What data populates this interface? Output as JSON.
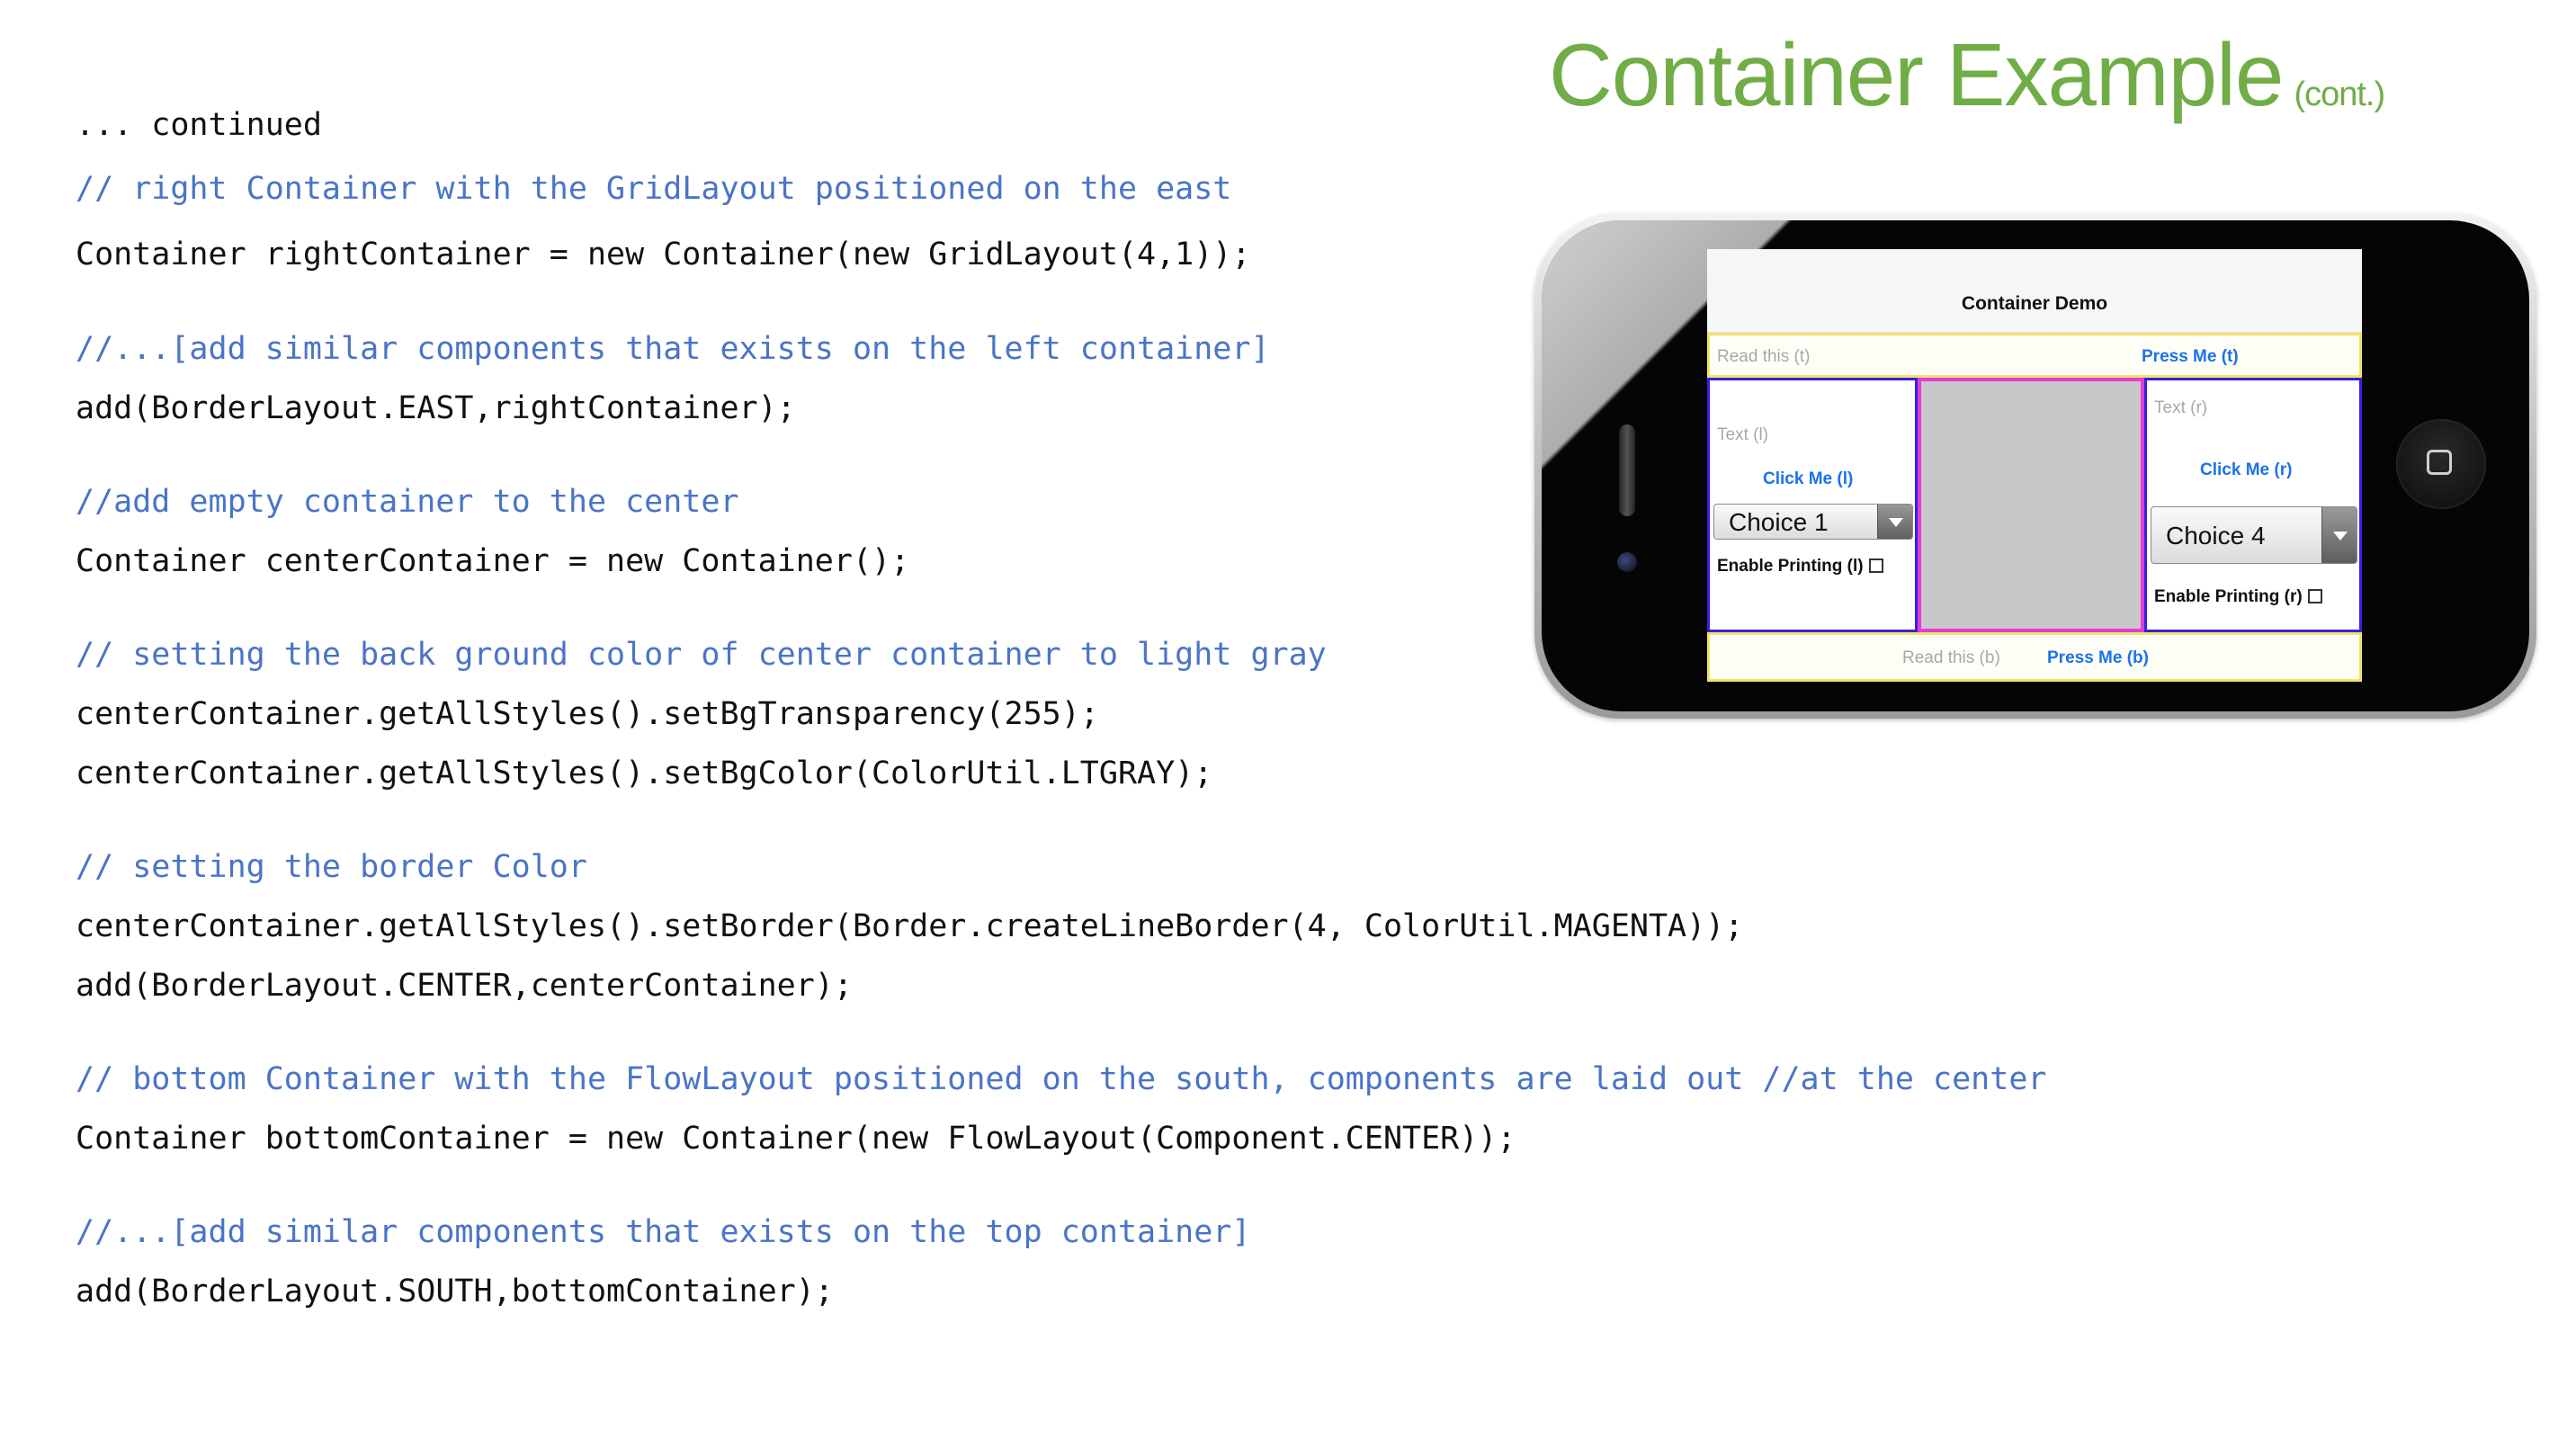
{
  "slide": {
    "title": "Container Example",
    "title_suffix": "(cont.)"
  },
  "code": {
    "lines": [
      {
        "type": "stmt",
        "text": "... continued"
      },
      {
        "type": "cmt",
        "text": "// right Container with the GridLayout positioned on the east"
      },
      {
        "type": "stmt",
        "text": "Container rightContainer = new Container(new GridLayout(4,1));"
      },
      {
        "type": "cmt",
        "text": "//...[add similar components that exists on the left container]"
      },
      {
        "type": "stmt",
        "text": "add(BorderLayout.EAST,rightContainer);"
      },
      {
        "type": "cmt",
        "text": "//add empty container to the center"
      },
      {
        "type": "stmt",
        "text": "Container centerContainer = new Container();"
      },
      {
        "type": "cmt",
        "text": "// setting the back ground color of center container to light gray"
      },
      {
        "type": "stmt",
        "text": "centerContainer.getAllStyles().setBgTransparency(255);"
      },
      {
        "type": "stmt",
        "text": "centerContainer.getAllStyles().setBgColor(ColorUtil.LTGRAY);"
      },
      {
        "type": "cmt",
        "text": "// setting the border Color"
      },
      {
        "type": "stmt",
        "text": "centerContainer.getAllStyles().setBorder(Border.createLineBorder(4, ColorUtil.MAGENTA));"
      },
      {
        "type": "stmt",
        "text": "add(BorderLayout.CENTER,centerContainer);"
      },
      {
        "type": "cmt",
        "text": "// bottom Container with the FlowLayout positioned on the south, components are laid out //at the center"
      },
      {
        "type": "stmt",
        "text": "Container bottomContainer = new Container(new FlowLayout(Component.CENTER));"
      },
      {
        "type": "cmt",
        "text": "//...[add similar components that exists on the top container]"
      },
      {
        "type": "stmt",
        "text": "add(BorderLayout.SOUTH,bottomContainer);"
      }
    ]
  },
  "phone_app": {
    "title": "Container Demo",
    "top": {
      "label": "Read this (t)",
      "button": "Press Me (t)"
    },
    "left": {
      "text": "Text (l)",
      "button": "Click Me (l)",
      "combo_value": "Choice 1",
      "checkbox_label": "Enable Printing (l)"
    },
    "right": {
      "text": "Text (r)",
      "button": "Click Me (r)",
      "combo_value": "Choice 4",
      "checkbox_label": "Enable Printing (r)"
    },
    "bottom": {
      "label": "Read this (b)",
      "button": "Press Me (b)"
    }
  },
  "colors": {
    "title": "#70ad47",
    "comment": "#4a74c7",
    "code": "#111111",
    "top_bottom_border": "#f2e26a",
    "side_border": "#3a1ee0",
    "center_border": "#e23bd8",
    "center_bg": "#c8c8c8"
  }
}
